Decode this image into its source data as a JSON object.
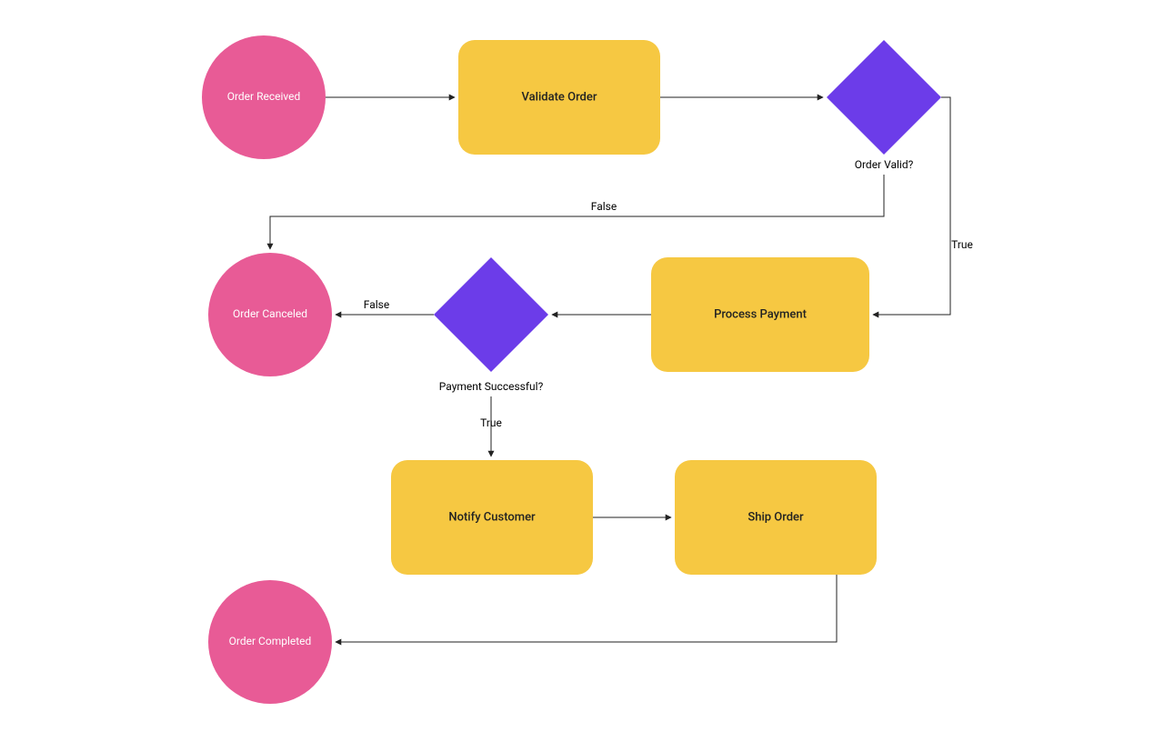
{
  "colors": {
    "pink": "#E85B96",
    "yellow": "#F6C842",
    "purple": "#6C3CE9",
    "stroke": "#222222"
  },
  "nodes": {
    "order_received": {
      "label": "Order Received"
    },
    "validate_order": {
      "label": "Validate Order"
    },
    "order_valid": {
      "caption": "Order Valid?"
    },
    "process_payment": {
      "label": "Process Payment"
    },
    "payment_success": {
      "caption": "Payment Successful?"
    },
    "order_canceled": {
      "label": "Order Canceled"
    },
    "notify_customer": {
      "label": "Notify Customer"
    },
    "ship_order": {
      "label": "Ship Order"
    },
    "order_completed": {
      "label": "Order Completed"
    }
  },
  "edges": {
    "valid_true": "True",
    "valid_false": "False",
    "pay_true": "True",
    "pay_false": "False"
  }
}
